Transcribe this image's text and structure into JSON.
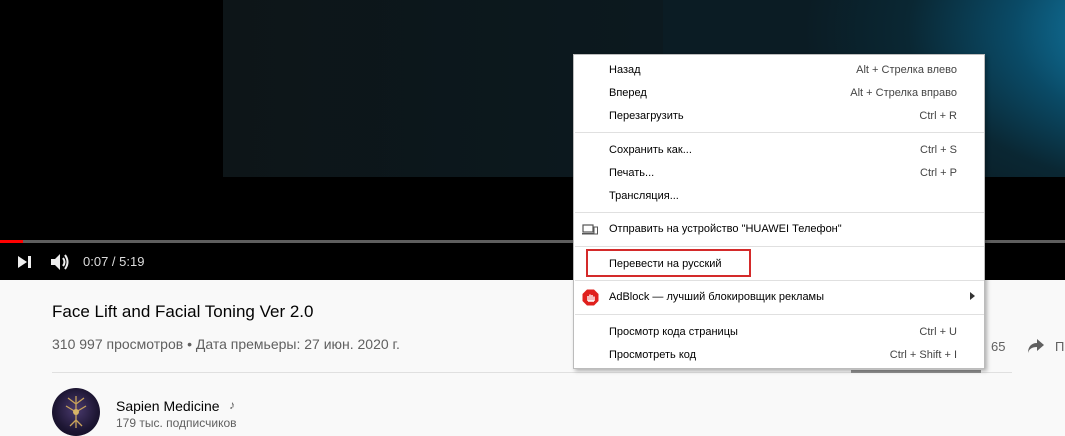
{
  "player": {
    "time_display": "0:07 / 5:19",
    "progress": 0.022,
    "icons": {
      "next": "skip-next-icon",
      "volume": "volume-icon"
    }
  },
  "video": {
    "title": "Face Lift and Facial Toning Ver 2.0",
    "meta": "310 997 просмотров • Дата премьеры: 27 июн. 2020 г.",
    "likes_partial": "65",
    "share_partial": "П"
  },
  "channel": {
    "name": "Sapien Medicine",
    "subscribers": "179 тыс. подписчиков",
    "badge_icon": "music-note-icon"
  },
  "context_menu": {
    "items": [
      {
        "label": "Назад",
        "shortcut": "Alt + Стрелка влево"
      },
      {
        "label": "Вперед",
        "shortcut": "Alt + Стрелка вправо"
      },
      {
        "label": "Перезагрузить",
        "shortcut": "Ctrl + R"
      },
      {
        "label": "Сохранить как...",
        "shortcut": "Ctrl + S"
      },
      {
        "label": "Печать...",
        "shortcut": "Ctrl + P"
      },
      {
        "label": "Трансляция...",
        "shortcut": ""
      },
      {
        "label": "Отправить на устройство \"HUAWEI Телефон\"",
        "shortcut": "",
        "icon": "device-icon"
      },
      {
        "label": "Перевести на русский",
        "shortcut": "",
        "highlighted": true
      },
      {
        "label": "AdBlock — лучший блокировщик рекламы",
        "shortcut": "",
        "icon": "adblock-icon",
        "submenu": true
      },
      {
        "label": "Просмотр кода страницы",
        "shortcut": "Ctrl + U"
      },
      {
        "label": "Просмотреть код",
        "shortcut": "Ctrl + Shift + I"
      }
    ],
    "highlight_color": "#d42a2a"
  }
}
